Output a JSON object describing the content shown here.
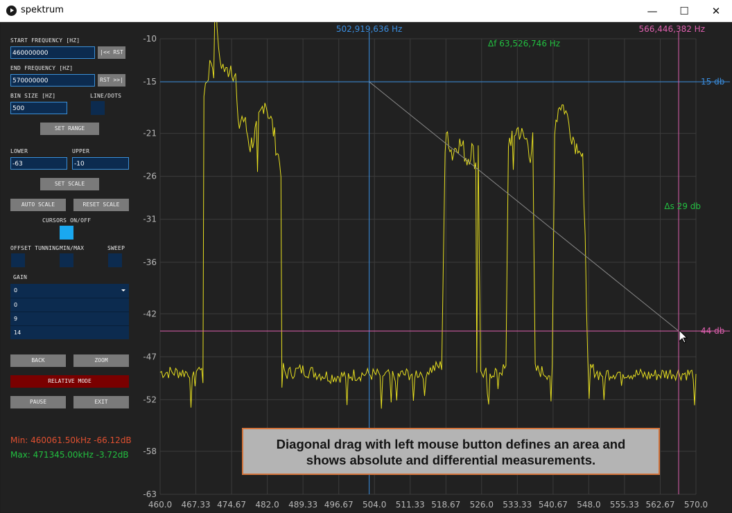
{
  "window": {
    "title": "spektrum",
    "minimize": "—",
    "maximize": "☐",
    "close": "✕"
  },
  "controls": {
    "start_freq_label": "START FREQUENCY [HZ]",
    "start_freq_value": "460000000",
    "rst_left": "|<< RST",
    "end_freq_label": "END FREQUENCY [HZ]",
    "end_freq_value": "570000000",
    "rst_right": "RST >>|",
    "bin_size_label": "BIN SIZE [HZ]",
    "bin_size_value": "500",
    "line_dots_label": "LINE/DOTS",
    "set_range": "SET RANGE",
    "lower_label": "LOWER",
    "lower_value": "-63",
    "upper_label": "UPPER",
    "upper_value": "-10",
    "set_scale": "SET SCALE",
    "auto_scale": "AUTO SCALE",
    "reset_scale": "RESET SCALE",
    "cursors_label": "CURSORS ON/OFF",
    "offset_label": "OFFSET TUNNING",
    "minmax_label": "MIN/MAX",
    "sweep_label": "SWEEP",
    "gain_label": "GAIN",
    "gain_selected": "0",
    "gain_options": [
      "0",
      "9",
      "14"
    ],
    "back": "BACK",
    "zoom": "ZOOM",
    "relative_mode": "RELATIVE MODE",
    "pause": "PAUSE",
    "exit": "EXIT"
  },
  "stats": {
    "min": "Min: 460061.50kHz -66.12dB",
    "max": "Max: 471345.00kHz -3.72dB"
  },
  "colors": {
    "trace": "#e8e020",
    "cursor_a": "#3a8ee0",
    "cursor_b": "#e060b0",
    "delta": "#22c040",
    "grid": "#3c3c3c",
    "axis_text": "#b8b8b8",
    "min_text": "#e05030",
    "max_text": "#22c040",
    "relative_btn": "#7a0000"
  },
  "cursors": {
    "a_freq_label": "502,919,636 Hz",
    "a_freq": 502.919636,
    "a_db_label": "15 db",
    "a_db": -15,
    "b_freq_label": "566,446,382 Hz",
    "b_freq": 566.446382,
    "b_db_label": "44 db",
    "b_db": -44,
    "delta_f": "Δf 63,526,746 Hz",
    "delta_s": "Δs 29 db"
  },
  "tooltip": {
    "line1": "Diagonal drag with left mouse button defines an area and",
    "line2": "shows absolute and differential measurements."
  },
  "chart_data": {
    "type": "line",
    "xlim": [
      460.0,
      570.0
    ],
    "ylim": [
      -63,
      -10
    ],
    "x_ticks": [
      "460.0",
      "467.33",
      "474.67",
      "482.0",
      "489.33",
      "496.67",
      "504.0",
      "511.33",
      "518.67",
      "526.0",
      "533.33",
      "540.67",
      "548.0",
      "555.33",
      "562.67",
      "570.0"
    ],
    "y_ticks": [
      "-10",
      "-15",
      "-21",
      "-26",
      "-31",
      "-36",
      "-42",
      "-47",
      "-52",
      "-58",
      "-63"
    ],
    "grid": true,
    "series": [
      {
        "x": [
          460.0,
          465.5,
          468.0,
          468.8,
          469.0,
          470.5,
          471.0,
          471.35,
          472.0,
          473.5,
          474.5,
          475.5,
          476.0,
          476.8,
          477.5,
          478.5,
          479.5,
          480.5,
          481.5,
          482.2,
          483.0,
          484.0,
          484.8,
          485.0,
          485.8,
          489.0,
          495.0,
          502.0,
          508.0,
          514.0,
          517.8,
          518.5,
          519.0,
          520.0,
          521.0,
          522.0,
          523.0,
          524.0,
          524.8,
          525.0,
          525.3,
          525.8,
          528.0,
          531.0,
          531.5,
          532.5,
          533.5,
          534.5,
          535.5,
          536.0,
          536.5,
          537.0,
          540.0,
          540.5,
          541.0,
          542.0,
          543.0,
          544.5,
          545.5,
          546.0,
          546.5,
          547.0,
          547.8,
          550.0,
          555.0,
          560.0,
          565.0,
          570.0
        ],
        "y": [
          -48.8,
          -48.8,
          -48.5,
          -47.5,
          -16.0,
          -12.5,
          -13.5,
          -3.72,
          -12.0,
          -14.0,
          -13.0,
          -14.5,
          -20.5,
          -19.0,
          -20.0,
          -22.5,
          -21.0,
          -19.0,
          -17.0,
          -18.5,
          -20.0,
          -23.0,
          -25.0,
          -48.0,
          -49.0,
          -48.5,
          -49.3,
          -49.0,
          -49.2,
          -48.8,
          -48.0,
          -23.0,
          -21.0,
          -23.5,
          -22.0,
          -22.5,
          -24.0,
          -22.8,
          -24.5,
          -48.5,
          -22.0,
          -49.0,
          -48.8,
          -48.5,
          -22.0,
          -21.0,
          -20.5,
          -21.5,
          -22.0,
          -23.5,
          -22.0,
          -48.5,
          -49.0,
          -48.0,
          -20.0,
          -17.5,
          -18.0,
          -21.0,
          -22.5,
          -22.0,
          -23.5,
          -24.0,
          -48.0,
          -49.0,
          -48.8,
          -49.2,
          -48.9,
          -49.0
        ]
      }
    ]
  }
}
